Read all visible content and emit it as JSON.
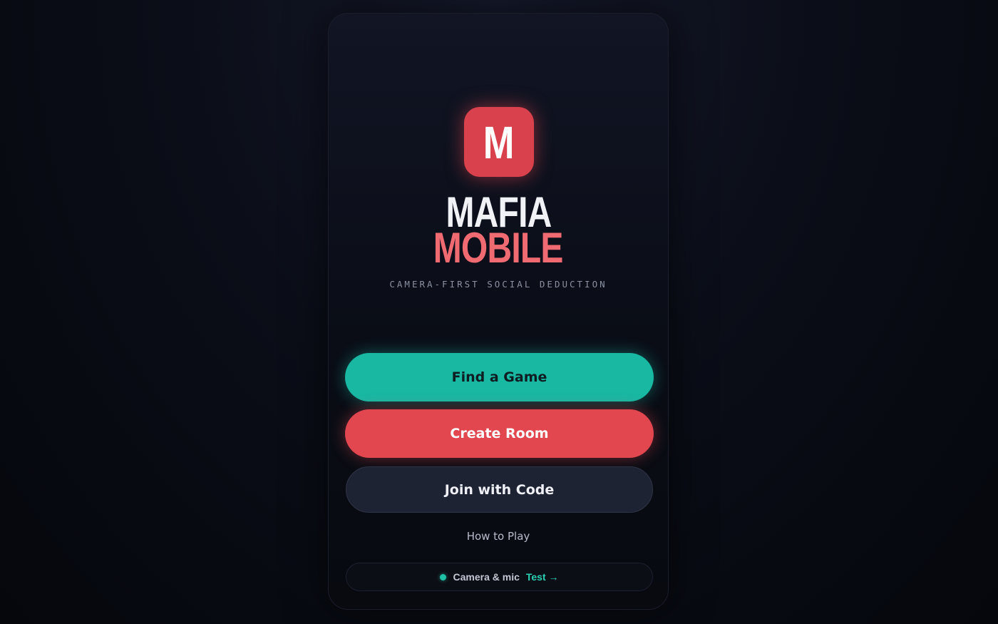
{
  "app": {
    "logo_letter": "M",
    "title_line1": "MAFIA",
    "title_line2": "MOBILE",
    "tagline": "CAMERA-FIRST SOCIAL DEDUCTION"
  },
  "actions": {
    "find_game": "Find a Game",
    "create_room": "Create Room",
    "join_code": "Join with Code",
    "how_to_play": "How to Play"
  },
  "device_status": {
    "label": "Camera & mic",
    "link": "Test →",
    "status_color": "#1fc2a8"
  },
  "colors": {
    "accent_red": "#e2464f",
    "accent_teal": "#18b8a3",
    "title_pink": "#f06a72"
  }
}
